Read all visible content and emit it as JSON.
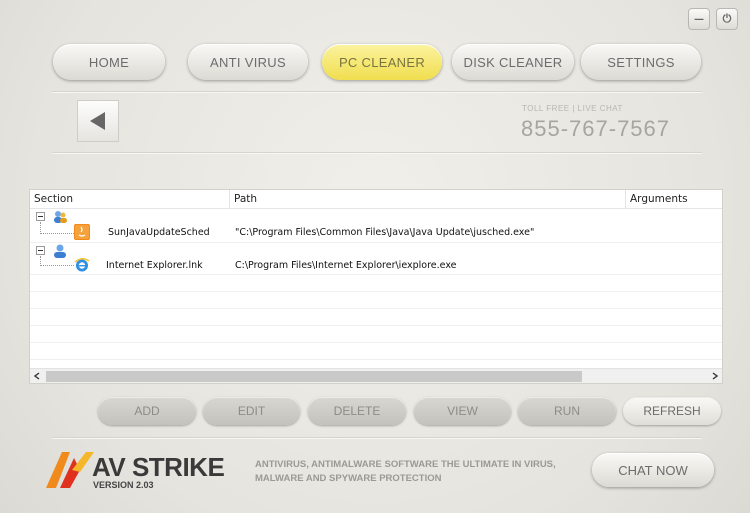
{
  "window_controls": {
    "minimize": "—",
    "power": "⏻"
  },
  "nav": {
    "items": [
      {
        "label": "HOME"
      },
      {
        "label": "ANTI VIRUS"
      },
      {
        "label": "PC CLEANER"
      },
      {
        "label": "DISK CLEANER"
      },
      {
        "label": "SETTINGS"
      }
    ],
    "active": "PC CLEANER"
  },
  "contact": {
    "label": "TOLL FREE | LIVE CHAT",
    "phone": "855-767-7567"
  },
  "table": {
    "columns": [
      "Section",
      "Path",
      "Arguments"
    ],
    "rows": [
      {
        "name": "SunJavaUpdateSched",
        "path": "\"C:\\Program Files\\Common Files\\Java\\Java Update\\jusched.exe\"",
        "arguments": ""
      },
      {
        "name": "Internet Explorer.lnk",
        "path": "C:\\Program Files\\Internet Explorer\\iexplore.exe",
        "arguments": ""
      }
    ]
  },
  "actions": {
    "add": "ADD",
    "edit": "EDIT",
    "delete": "DELETE",
    "view": "VIEW",
    "run": "RUN",
    "refresh": "REFRESH"
  },
  "footer": {
    "brand_av": "AV",
    "brand_strike": "STRIKE",
    "version": "VERSION 2.03",
    "tagline": "ANTIVIRUS, ANTIMALWARE SOFTWARE THE ULTIMATE IN VIRUS, MALWARE AND SPYWARE PROTECTION",
    "chat_now": "CHAT NOW"
  },
  "colors": {
    "accent": "#f0de4e",
    "logo_orange": "#f08a1c",
    "logo_red": "#e0301e"
  }
}
